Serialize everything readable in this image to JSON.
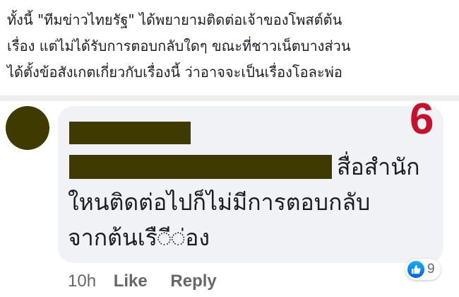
{
  "article": {
    "lines": [
      "ทั้งนี้ \"ทีมข่าวไทยรัฐ\" ได้พยายามติดต่อเจ้าของโพสต์ต้น",
      "เรื่อง แต่ไม่ได้รับการตอบกลับใดๆ ขณะที่ชาวเน็ตบางส่วน",
      "ได้ตั้งข้อสังเกตเกี่ยวกับเรื่องนี้ ว่าอาจจะเป็นเรื่องโอละพ่อ"
    ]
  },
  "comment": {
    "badge_number": "6",
    "text_lines": [
      "สื่อสำนัก",
      "ใหนติดต่อไปก็ไม่มีการตอบกลับ",
      "จากต้นเรื◌ี◌่อง"
    ],
    "timestamp": "10h",
    "like_label": "Like",
    "reply_label": "Reply",
    "reaction_icon": "thumbs-up-icon",
    "reaction_count": "9"
  },
  "colors": {
    "redaction": "#3f3a00",
    "badge_number": "#c8102e",
    "bubble": "#f0f2f5",
    "like_blue": "#1877f2"
  }
}
